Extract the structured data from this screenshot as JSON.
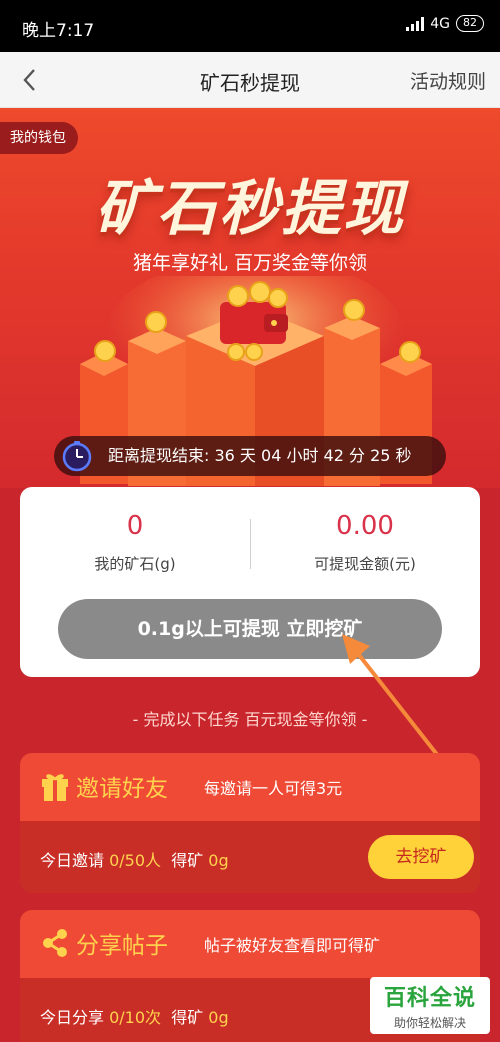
{
  "status_bar": {
    "time": "晚上7:17",
    "network": "4G",
    "battery": "82",
    "icons": [
      "signal-icon",
      "battery-icon"
    ]
  },
  "nav": {
    "title": "矿石秒提现",
    "rules_label": "活动规则",
    "back_icon": "chevron-left-icon"
  },
  "hero": {
    "wallet_tag": "我的钱包",
    "title": "矿石秒提现",
    "subtitle": "猪年享好礼 百万奖金等你领",
    "countdown": "距离提现结束: 36 天 04 小时 42 分 25 秒",
    "timer_icon": "stopwatch-icon"
  },
  "stats": {
    "ore_value": "0",
    "ore_label": "我的矿石(g)",
    "cash_value": "0.00",
    "cash_label": "可提现金额(元)"
  },
  "withdraw_button": "0.1g以上可提现 立即挖矿",
  "tasks_hint": "- 完成以下任务 百元现金等你领 -",
  "tasks": [
    {
      "icon": "gift-icon",
      "title": "邀请好友",
      "description": "每邀请一人可得3元",
      "progress_prefix": "今日邀请 ",
      "progress": "0/50人",
      "reward_prefix": "得矿 ",
      "reward": "0g",
      "button": "去挖矿"
    },
    {
      "icon": "share-icon",
      "title": "分享帖子",
      "description": "帖子被好友查看即可得矿",
      "progress_prefix": "今日分享 ",
      "progress": "0/10次",
      "reward_prefix": "得矿 ",
      "reward": "0g"
    }
  ],
  "watermark": {
    "main": "百科全说",
    "sub": "助你轻松解决"
  },
  "colors": {
    "background": "#c8262c",
    "accent_gold": "#ffd24d",
    "stat_value": "#d9324a",
    "button_disabled": "#8a8a8a"
  }
}
